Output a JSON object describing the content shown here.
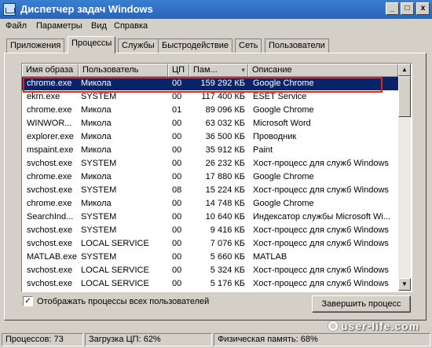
{
  "window": {
    "title": "Диспетчер задач Windows",
    "min": "_",
    "max": "□",
    "close": "x"
  },
  "menu": [
    "Файл",
    "Параметры",
    "Вид",
    "Справка"
  ],
  "tabs": [
    "Приложения",
    "Процессы",
    "Службы",
    "Быстродействие",
    "Сеть",
    "Пользователи"
  ],
  "active_tab": "Процессы",
  "columns": [
    "Имя образа",
    "Пользователь",
    "ЦП",
    "Пам...",
    "Описание"
  ],
  "sorted_column": "Пам...",
  "processes": [
    {
      "name": "chrome.exe",
      "user": "Микола",
      "cpu": "00",
      "mem": "159 292 КБ",
      "desc": "Google Chrome",
      "selected": true
    },
    {
      "name": "ekrn.exe",
      "user": "SYSTEM",
      "cpu": "00",
      "mem": "117 400 КБ",
      "desc": "ESET Service"
    },
    {
      "name": "chrome.exe",
      "user": "Микола",
      "cpu": "01",
      "mem": "89 096 КБ",
      "desc": "Google Chrome"
    },
    {
      "name": "WINWOR...",
      "user": "Микола",
      "cpu": "00",
      "mem": "63 032 КБ",
      "desc": "Microsoft Word"
    },
    {
      "name": "explorer.exe",
      "user": "Микола",
      "cpu": "00",
      "mem": "36 500 КБ",
      "desc": "Проводник"
    },
    {
      "name": "mspaint.exe",
      "user": "Микола",
      "cpu": "00",
      "mem": "35 912 КБ",
      "desc": "Paint"
    },
    {
      "name": "svchost.exe",
      "user": "SYSTEM",
      "cpu": "00",
      "mem": "26 232 КБ",
      "desc": "Хост-процесс для служб Windows"
    },
    {
      "name": "chrome.exe",
      "user": "Микола",
      "cpu": "00",
      "mem": "17 880 КБ",
      "desc": "Google Chrome"
    },
    {
      "name": "svchost.exe",
      "user": "SYSTEM",
      "cpu": "08",
      "mem": "15 224 КБ",
      "desc": "Хост-процесс для служб Windows"
    },
    {
      "name": "chrome.exe",
      "user": "Микола",
      "cpu": "00",
      "mem": "14 748 КБ",
      "desc": "Google Chrome"
    },
    {
      "name": "SearchInd...",
      "user": "SYSTEM",
      "cpu": "00",
      "mem": "10 640 КБ",
      "desc": "Индексатор службы Microsoft Wi..."
    },
    {
      "name": "svchost.exe",
      "user": "SYSTEM",
      "cpu": "00",
      "mem": "9 416 КБ",
      "desc": "Хост-процесс для служб Windows"
    },
    {
      "name": "svchost.exe",
      "user": "LOCAL SERVICE",
      "cpu": "00",
      "mem": "7 076 КБ",
      "desc": "Хост-процесс для служб Windows"
    },
    {
      "name": "MATLAB.exe",
      "user": "SYSTEM",
      "cpu": "00",
      "mem": "5 660 КБ",
      "desc": "MATLAB"
    },
    {
      "name": "svchost.exe",
      "user": "LOCAL SERVICE",
      "cpu": "00",
      "mem": "5 324 КБ",
      "desc": "Хост-процесс для служб Windows"
    },
    {
      "name": "svchost.exe",
      "user": "LOCAL SERVICE",
      "cpu": "00",
      "mem": "5 176 КБ",
      "desc": "Хост-процесс для служб Windows"
    }
  ],
  "show_all_users": {
    "label": "Отображать процессы всех пользователей",
    "checked": true,
    "mark": "✓"
  },
  "end_process_label": "Завершить процесс",
  "status": {
    "processes": "Процессов: 73",
    "cpu": "Загрузка ЦП: 62%",
    "memory": "Физическая память: 68%"
  },
  "watermark": "user-life.com",
  "scroll": {
    "up": "▲",
    "down": "▼"
  }
}
